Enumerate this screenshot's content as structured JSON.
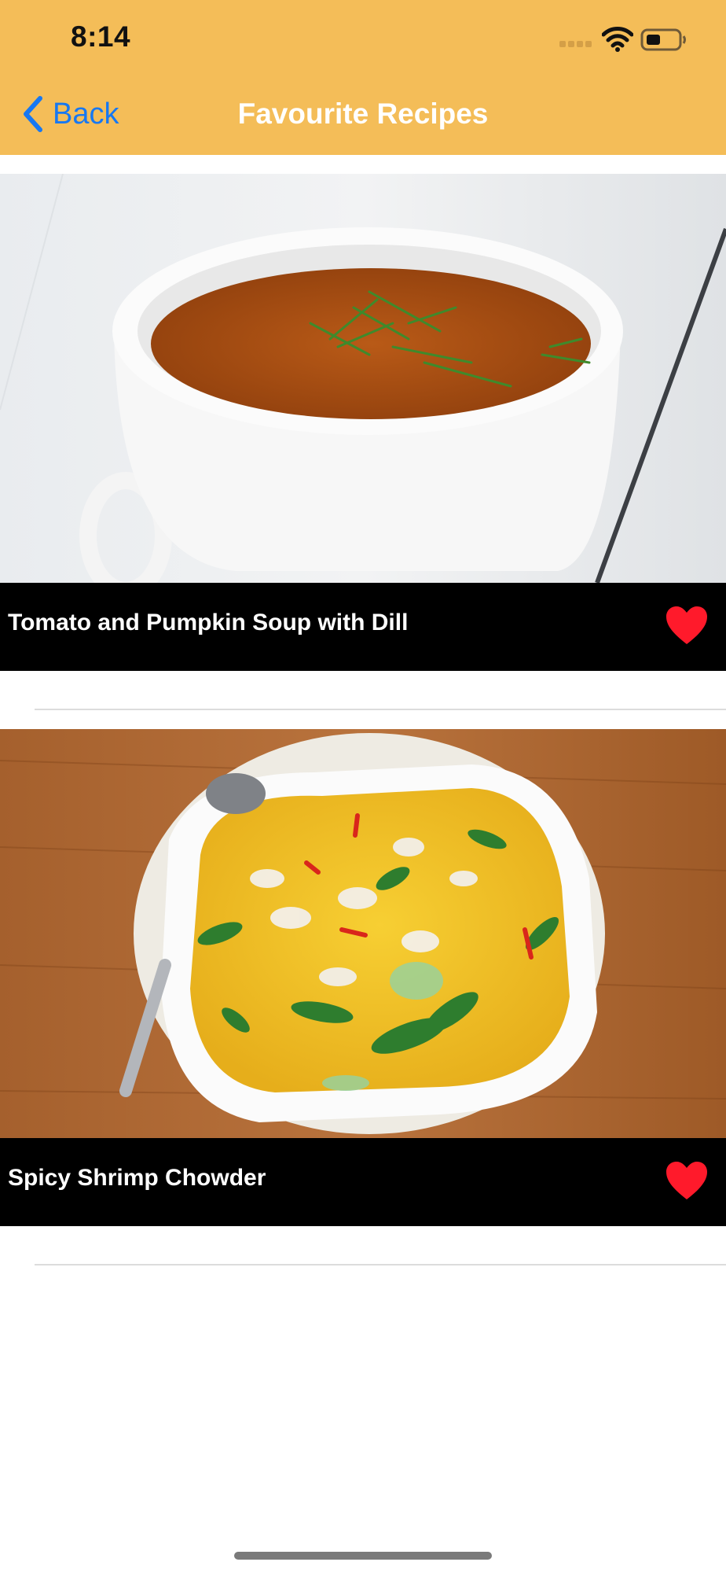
{
  "status_bar": {
    "time": "8:14"
  },
  "nav": {
    "back_label": "Back",
    "title": "Favourite Recipes"
  },
  "recipes": [
    {
      "title": "Tomato and Pumpkin Soup with Dill",
      "favourite": true
    },
    {
      "title": "Spicy Shrimp Chowder",
      "favourite": true
    }
  ],
  "colors": {
    "header": "#f4bd58",
    "accent_link": "#1778f2",
    "heart": "#ff1a2b"
  }
}
